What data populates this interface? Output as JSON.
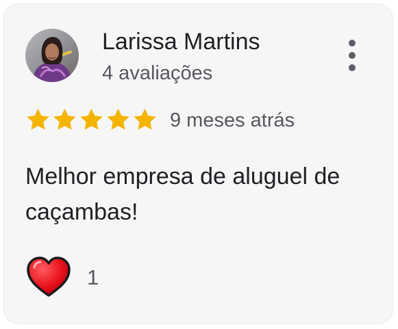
{
  "review": {
    "author_name": "Larissa Martins",
    "author_reviews": "4 avaliações",
    "rating": 5,
    "rating_max": 5,
    "date": "9 meses atrás",
    "text": "Melhor empresa de aluguel de caçambas!",
    "likes": "1"
  },
  "icons": {
    "menu": "more-vertical-icon",
    "star": "star-icon",
    "like": "heart-icon"
  },
  "colors": {
    "card_bg": "#f6f6f7",
    "star": "#f5b400",
    "heart": "#e8101b",
    "text_primary": "#1f1f24",
    "text_secondary": "#55585e"
  }
}
